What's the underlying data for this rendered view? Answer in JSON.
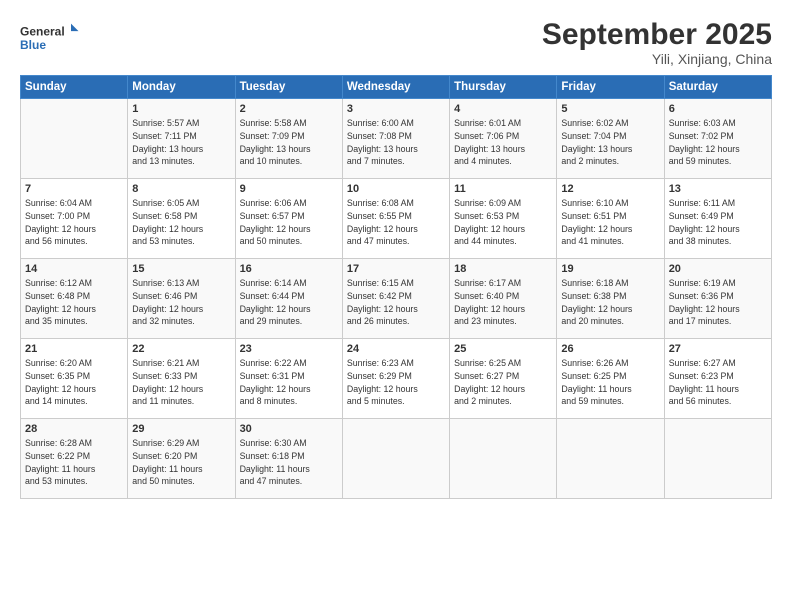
{
  "logo": {
    "text_general": "General",
    "text_blue": "Blue"
  },
  "header": {
    "month": "September 2025",
    "location": "Yili, Xinjiang, China"
  },
  "columns": [
    "Sunday",
    "Monday",
    "Tuesday",
    "Wednesday",
    "Thursday",
    "Friday",
    "Saturday"
  ],
  "weeks": [
    [
      {
        "day": "",
        "info": ""
      },
      {
        "day": "1",
        "info": "Sunrise: 5:57 AM\nSunset: 7:11 PM\nDaylight: 13 hours\nand 13 minutes."
      },
      {
        "day": "2",
        "info": "Sunrise: 5:58 AM\nSunset: 7:09 PM\nDaylight: 13 hours\nand 10 minutes."
      },
      {
        "day": "3",
        "info": "Sunrise: 6:00 AM\nSunset: 7:08 PM\nDaylight: 13 hours\nand 7 minutes."
      },
      {
        "day": "4",
        "info": "Sunrise: 6:01 AM\nSunset: 7:06 PM\nDaylight: 13 hours\nand 4 minutes."
      },
      {
        "day": "5",
        "info": "Sunrise: 6:02 AM\nSunset: 7:04 PM\nDaylight: 13 hours\nand 2 minutes."
      },
      {
        "day": "6",
        "info": "Sunrise: 6:03 AM\nSunset: 7:02 PM\nDaylight: 12 hours\nand 59 minutes."
      }
    ],
    [
      {
        "day": "7",
        "info": "Sunrise: 6:04 AM\nSunset: 7:00 PM\nDaylight: 12 hours\nand 56 minutes."
      },
      {
        "day": "8",
        "info": "Sunrise: 6:05 AM\nSunset: 6:58 PM\nDaylight: 12 hours\nand 53 minutes."
      },
      {
        "day": "9",
        "info": "Sunrise: 6:06 AM\nSunset: 6:57 PM\nDaylight: 12 hours\nand 50 minutes."
      },
      {
        "day": "10",
        "info": "Sunrise: 6:08 AM\nSunset: 6:55 PM\nDaylight: 12 hours\nand 47 minutes."
      },
      {
        "day": "11",
        "info": "Sunrise: 6:09 AM\nSunset: 6:53 PM\nDaylight: 12 hours\nand 44 minutes."
      },
      {
        "day": "12",
        "info": "Sunrise: 6:10 AM\nSunset: 6:51 PM\nDaylight: 12 hours\nand 41 minutes."
      },
      {
        "day": "13",
        "info": "Sunrise: 6:11 AM\nSunset: 6:49 PM\nDaylight: 12 hours\nand 38 minutes."
      }
    ],
    [
      {
        "day": "14",
        "info": "Sunrise: 6:12 AM\nSunset: 6:48 PM\nDaylight: 12 hours\nand 35 minutes."
      },
      {
        "day": "15",
        "info": "Sunrise: 6:13 AM\nSunset: 6:46 PM\nDaylight: 12 hours\nand 32 minutes."
      },
      {
        "day": "16",
        "info": "Sunrise: 6:14 AM\nSunset: 6:44 PM\nDaylight: 12 hours\nand 29 minutes."
      },
      {
        "day": "17",
        "info": "Sunrise: 6:15 AM\nSunset: 6:42 PM\nDaylight: 12 hours\nand 26 minutes."
      },
      {
        "day": "18",
        "info": "Sunrise: 6:17 AM\nSunset: 6:40 PM\nDaylight: 12 hours\nand 23 minutes."
      },
      {
        "day": "19",
        "info": "Sunrise: 6:18 AM\nSunset: 6:38 PM\nDaylight: 12 hours\nand 20 minutes."
      },
      {
        "day": "20",
        "info": "Sunrise: 6:19 AM\nSunset: 6:36 PM\nDaylight: 12 hours\nand 17 minutes."
      }
    ],
    [
      {
        "day": "21",
        "info": "Sunrise: 6:20 AM\nSunset: 6:35 PM\nDaylight: 12 hours\nand 14 minutes."
      },
      {
        "day": "22",
        "info": "Sunrise: 6:21 AM\nSunset: 6:33 PM\nDaylight: 12 hours\nand 11 minutes."
      },
      {
        "day": "23",
        "info": "Sunrise: 6:22 AM\nSunset: 6:31 PM\nDaylight: 12 hours\nand 8 minutes."
      },
      {
        "day": "24",
        "info": "Sunrise: 6:23 AM\nSunset: 6:29 PM\nDaylight: 12 hours\nand 5 minutes."
      },
      {
        "day": "25",
        "info": "Sunrise: 6:25 AM\nSunset: 6:27 PM\nDaylight: 12 hours\nand 2 minutes."
      },
      {
        "day": "26",
        "info": "Sunrise: 6:26 AM\nSunset: 6:25 PM\nDaylight: 11 hours\nand 59 minutes."
      },
      {
        "day": "27",
        "info": "Sunrise: 6:27 AM\nSunset: 6:23 PM\nDaylight: 11 hours\nand 56 minutes."
      }
    ],
    [
      {
        "day": "28",
        "info": "Sunrise: 6:28 AM\nSunset: 6:22 PM\nDaylight: 11 hours\nand 53 minutes."
      },
      {
        "day": "29",
        "info": "Sunrise: 6:29 AM\nSunset: 6:20 PM\nDaylight: 11 hours\nand 50 minutes."
      },
      {
        "day": "30",
        "info": "Sunrise: 6:30 AM\nSunset: 6:18 PM\nDaylight: 11 hours\nand 47 minutes."
      },
      {
        "day": "",
        "info": ""
      },
      {
        "day": "",
        "info": ""
      },
      {
        "day": "",
        "info": ""
      },
      {
        "day": "",
        "info": ""
      }
    ]
  ]
}
